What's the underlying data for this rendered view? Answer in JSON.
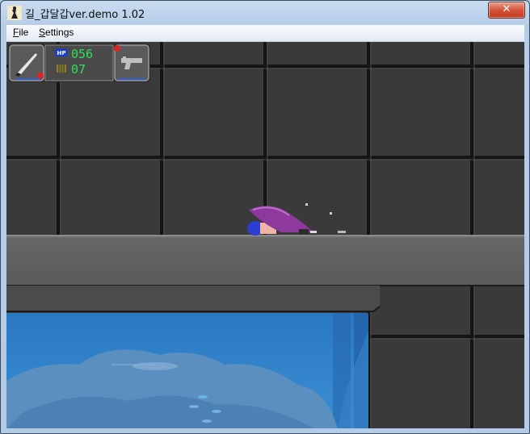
{
  "window": {
    "title": "길_갑달갑ver.demo 1.02",
    "close_label": "✕"
  },
  "menu": {
    "items": [
      {
        "underline": "F",
        "rest": "ile"
      },
      {
        "underline": "S",
        "rest": "ettings"
      }
    ]
  },
  "hud": {
    "hp_badge": "HP",
    "hp_value": "056",
    "ammo_value": "07",
    "melee_weapon": "knife-icon",
    "ranged_weapon": "pistol-icon"
  },
  "colors": {
    "hud_text": "#2ee05a",
    "wall": "#3b3b3b",
    "floor": "#616161",
    "water": "#2f7fc4"
  }
}
